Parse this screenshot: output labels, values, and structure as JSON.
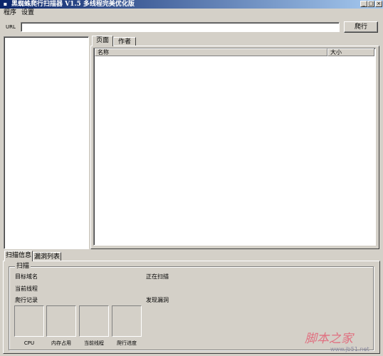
{
  "window": {
    "title": "黑蜘蛛爬行扫描器 V1.5 多线程完美优化版",
    "controls": {
      "minimize": "_",
      "maximize": "□",
      "close": "×"
    }
  },
  "menu": {
    "items": [
      "程序",
      "设置"
    ]
  },
  "url_bar": {
    "label": "URL",
    "value": "",
    "crawl_button": "爬行"
  },
  "right_tabs": [
    "页面",
    "作者"
  ],
  "table": {
    "columns": [
      "名称",
      "大小"
    ],
    "rows": []
  },
  "bottom_tabs": [
    "扫描信息",
    "漏洞列表"
  ],
  "scan_group": {
    "title": "扫描",
    "target_domain": "目标域名",
    "current_thread": "当前线程",
    "crawl_log": "爬行记录",
    "scanning": "正在扫描",
    "found_vuln": "发现漏洞"
  },
  "meters": [
    "CPU",
    "内存占用",
    "当前线程",
    "爬行进度"
  ],
  "watermark": {
    "text": "脚本之家",
    "url": "www.jb51.net"
  },
  "colors": {
    "titlebar_start": "#0a246a",
    "titlebar_end": "#a6caf0",
    "face": "#d4d0c8",
    "watermark": "#e07080"
  },
  "icons": {
    "app": "app-icon"
  }
}
